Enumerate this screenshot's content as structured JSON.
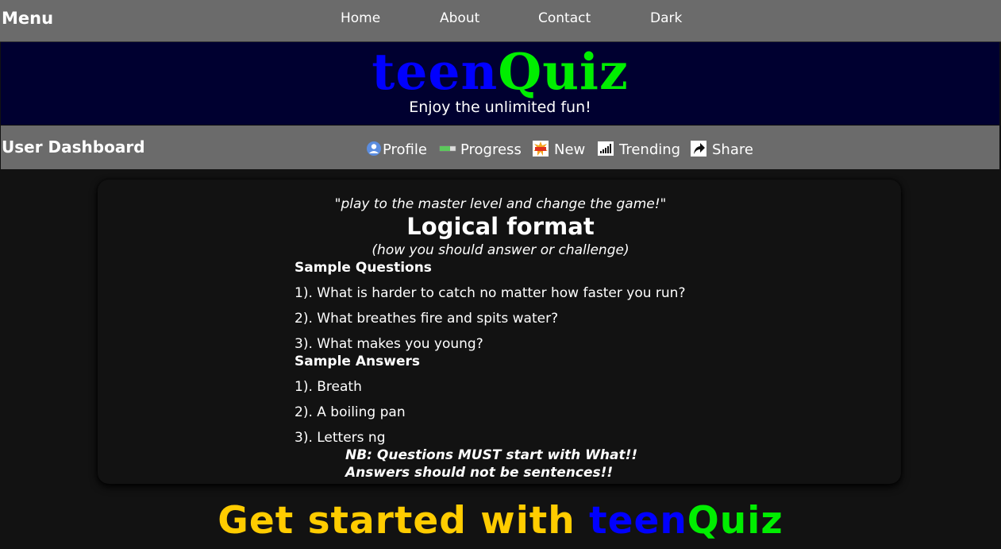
{
  "topbar": {
    "menu_label": "Menu",
    "nav": [
      {
        "label": "Home"
      },
      {
        "label": "About"
      },
      {
        "label": "Contact"
      },
      {
        "label": "Dark"
      }
    ]
  },
  "banner": {
    "logo_part1": "teen",
    "logo_part2": "Quiz",
    "tagline": "Enjoy the unlimited fun!"
  },
  "dashboard": {
    "title": "User Dashboard",
    "items": [
      {
        "label": "Profile",
        "icon": "profile-icon"
      },
      {
        "label": "Progress",
        "icon": "progress-icon"
      },
      {
        "label": "New",
        "icon": "new-icon"
      },
      {
        "label": "Trending",
        "icon": "trending-icon"
      },
      {
        "label": "Share",
        "icon": "share-icon"
      }
    ]
  },
  "card": {
    "quote": "\"play to the master level and change the game!\"",
    "title": "Logical format",
    "subtitle": "(how you should answer or challenge)",
    "questions_heading": "Sample Questions",
    "questions": [
      "1). What is harder to catch no matter how faster you run?",
      "2). What breathes fire and spits water?",
      "3). What makes you young?"
    ],
    "answers_heading": "Sample Answers",
    "answers": [
      "1). Breath",
      "2). A boiling pan",
      "3). Letters ng"
    ],
    "nb1": "NB: Questions MUST start with What!!",
    "nb2": "Answers should not be sentences!!"
  },
  "footer_cta": {
    "prefix": "Get started with",
    "part1": "teen",
    "part2": "Quiz"
  },
  "colors": {
    "topbar_bg": "#6b6b6b",
    "banner_bg": "#000030",
    "logo_teen": "#0000ff",
    "logo_quiz": "#00ee00",
    "cta_yellow": "#ffcc00",
    "page_bg": "#121212"
  }
}
